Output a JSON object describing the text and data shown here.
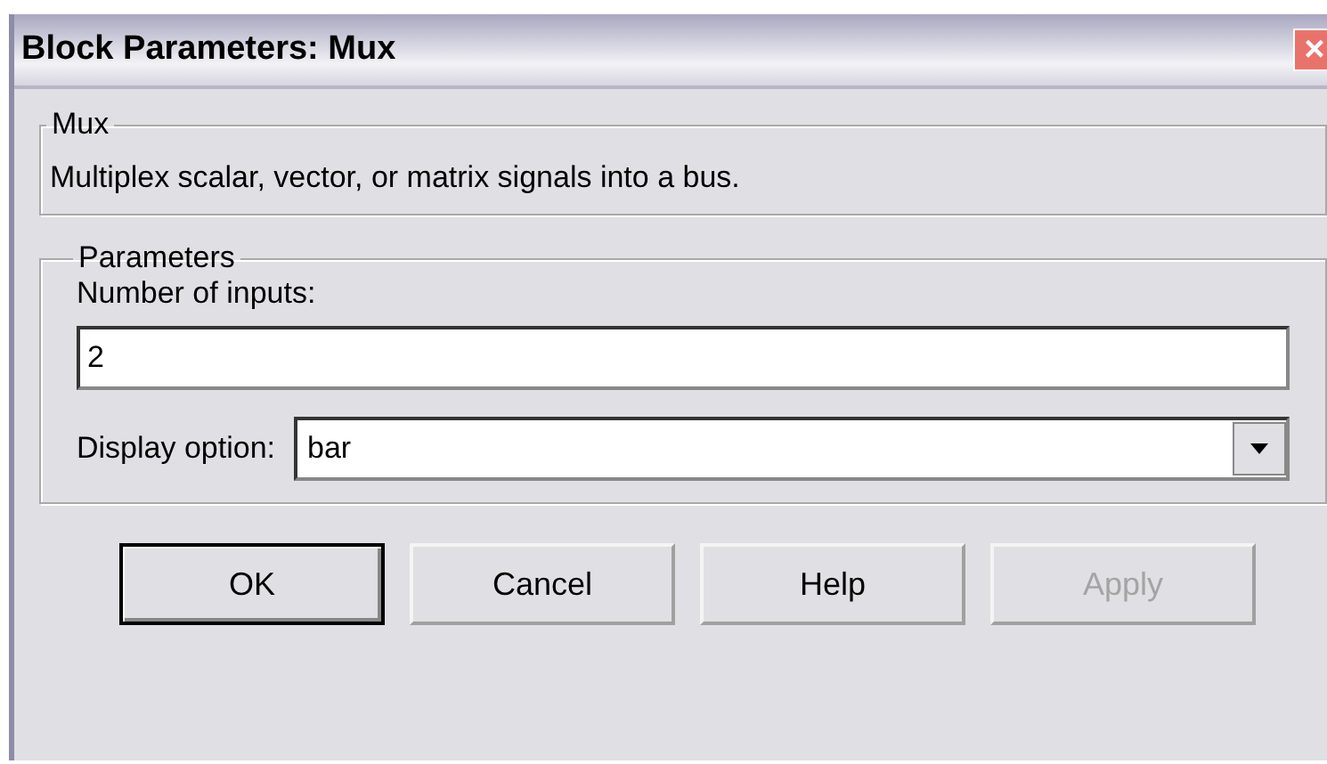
{
  "window": {
    "title": "Block Parameters: Mux",
    "close": "×"
  },
  "description_group": {
    "title": "Mux",
    "text": "Multiplex scalar, vector, or matrix signals into a bus."
  },
  "parameters_group": {
    "title": "Parameters",
    "fields": [
      {
        "kind": "text",
        "label": "Number of inputs:",
        "value": "2"
      },
      {
        "kind": "dropdown",
        "label": "Display option:",
        "value": "bar"
      }
    ]
  },
  "buttons": [
    {
      "label": "OK",
      "default": true,
      "disabled": false
    },
    {
      "label": "Cancel",
      "default": false,
      "disabled": false
    },
    {
      "label": "Help",
      "default": false,
      "disabled": false
    },
    {
      "label": "Apply",
      "default": false,
      "disabled": true
    }
  ]
}
